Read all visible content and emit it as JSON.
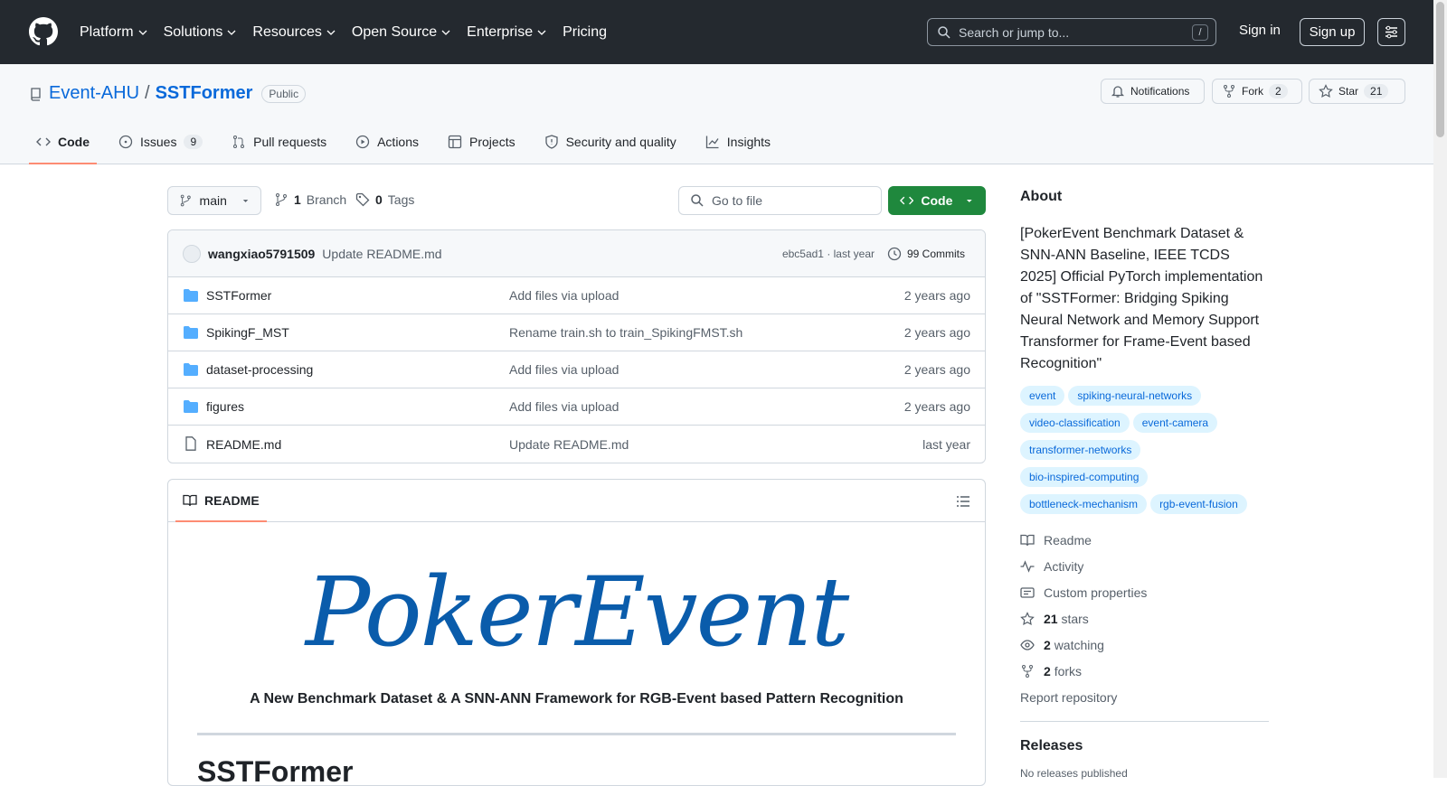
{
  "header": {
    "nav": [
      {
        "label": "Platform",
        "dropdown": true
      },
      {
        "label": "Solutions",
        "dropdown": true
      },
      {
        "label": "Resources",
        "dropdown": true
      },
      {
        "label": "Open Source",
        "dropdown": true
      },
      {
        "label": "Enterprise",
        "dropdown": true
      },
      {
        "label": "Pricing",
        "dropdown": false
      }
    ],
    "search_placeholder": "Search or jump to...",
    "search_shortcut": "/",
    "signin": "Sign in",
    "signup": "Sign up"
  },
  "repo": {
    "owner": "Event-AHU",
    "separator": "/",
    "name": "SSTFormer",
    "visibility": "Public",
    "notifications": "Notifications",
    "fork_label": "Fork",
    "fork_count": "2",
    "star_label": "Star",
    "star_count": "21"
  },
  "tabs": [
    {
      "label": "Code",
      "icon": "code-icon",
      "active": true
    },
    {
      "label": "Issues",
      "icon": "issue-icon",
      "count": "9"
    },
    {
      "label": "Pull requests",
      "icon": "pull-request-icon"
    },
    {
      "label": "Actions",
      "icon": "play-icon"
    },
    {
      "label": "Projects",
      "icon": "table-icon"
    },
    {
      "label": "Security and quality",
      "icon": "shield-icon"
    },
    {
      "label": "Insights",
      "icon": "graph-icon"
    }
  ],
  "toolbar": {
    "branch": "main",
    "branch_count": "1",
    "branch_label": "Branch",
    "tag_count": "0",
    "tag_label": "Tags",
    "goto_placeholder": "Go to file",
    "code_button": "Code"
  },
  "commit": {
    "author": "wangxiao5791509",
    "message": "Update README.md",
    "hash_time": "ebc5ad1 · last year",
    "commits": "99 Commits"
  },
  "files": [
    {
      "name": "SSTFormer",
      "type": "folder",
      "message": "Add files via upload",
      "date": "2 years ago"
    },
    {
      "name": "SpikingF_MST",
      "type": "folder",
      "message": "Rename train.sh to train_SpikingFMST.sh",
      "date": "2 years ago"
    },
    {
      "name": "dataset-processing",
      "type": "folder",
      "message": "Add files via upload",
      "date": "2 years ago"
    },
    {
      "name": "figures",
      "type": "folder",
      "message": "Add files via upload",
      "date": "2 years ago"
    },
    {
      "name": "README.md",
      "type": "file",
      "message": "Update README.md",
      "date": "last year"
    }
  ],
  "readme": {
    "tab": "README",
    "logo_text": "PokerEvent",
    "subtitle": "A New Benchmark Dataset & A SNN-ANN Framework for RGB-Event based Pattern Recognition",
    "heading": "SSTFormer"
  },
  "about": {
    "title": "About",
    "description": "[PokerEvent Benchmark Dataset & SNN-ANN Baseline, IEEE TCDS 2025] Official PyTorch implementation of \"SSTFormer: Bridging Spiking Neural Network and Memory Support Transformer for Frame-Event based Recognition\"",
    "topics": [
      "event",
      "spiking-neural-networks",
      "video-classification",
      "event-camera",
      "transformer-networks",
      "bio-inspired-computing",
      "bottleneck-mechanism",
      "rgb-event-fusion"
    ],
    "readme": "Readme",
    "activity": "Activity",
    "custom": "Custom properties",
    "stars_n": "21",
    "stars": "stars",
    "watching_n": "2",
    "watching": "watching",
    "forks_n": "2",
    "forks": "forks",
    "report": "Report repository",
    "releases": "Releases",
    "no_releases": "No releases published"
  },
  "colors": {
    "header_bg": "#24292f",
    "link": "#0969da",
    "green": "#1f883d",
    "tab_underline": "#fd8c73"
  }
}
